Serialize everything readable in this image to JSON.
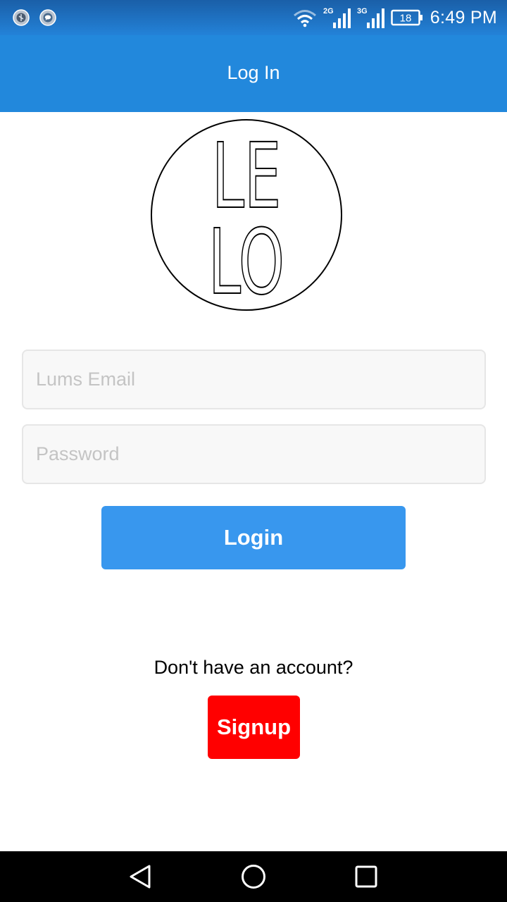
{
  "status_bar": {
    "network_2g": "2G",
    "network_3g": "3G",
    "battery": "18",
    "time": "6:49 PM",
    "icons": [
      "notification-app-icon",
      "message-icon",
      "wifi-icon",
      "signal-2g-icon",
      "signal-3g-icon",
      "battery-icon"
    ]
  },
  "app_bar": {
    "title": "Log In"
  },
  "logo": {
    "text_top": "LE",
    "text_bottom": "LO"
  },
  "form": {
    "email_placeholder": "Lums Email",
    "email_value": "",
    "password_placeholder": "Password",
    "password_value": "",
    "login_label": "Login"
  },
  "signup": {
    "prompt": "Don't have an account?",
    "button_label": "Signup"
  },
  "nav_bar": {
    "icons": [
      "back-icon",
      "home-icon",
      "recents-icon"
    ]
  },
  "colors": {
    "app_bar": "#2288dc",
    "login_button": "#3897ee",
    "signup_button": "#ff0000"
  }
}
